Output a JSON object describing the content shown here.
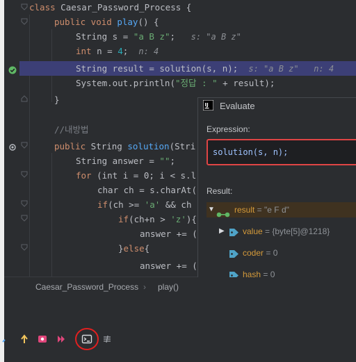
{
  "code_lines": [
    {
      "kw": "class",
      "name": "Caesar_Password_Process",
      "rest": " {"
    },
    {
      "kw": "public void",
      "name": "play",
      "rest": "() {"
    },
    {
      "text": "String s = ",
      "str": "\"a B z\"",
      "rest": ";",
      "hint": "s: \"a B z\""
    },
    {
      "kw": "int",
      "rest": " n = ",
      "num": "4",
      "rest2": ";",
      "hint": "n: 4"
    },
    {
      "text": "String result = solution(s, n);",
      "hint": "s: \"a B z\"   n: 4"
    },
    {
      "text": "System.out.println(",
      "str": "\"정답 : \"",
      "rest": " + result);"
    },
    {
      "text": "}"
    },
    {
      "comment": "//내방법"
    },
    {
      "kw": "public",
      "text": " String ",
      "name": "solution",
      "rest": "(Stri"
    },
    {
      "text": "String answer = ",
      "str": "\"\"",
      "rest": ";"
    },
    {
      "kw": "for",
      "text": " (int i = 0; i < s.l"
    },
    {
      "text": "char ch = s.charAt("
    },
    {
      "kw": "if",
      "text": "(ch >= ",
      "str": "'a'",
      "rest": " && ch"
    },
    {
      "kw": "if",
      "text": "(ch+n > ",
      "str": "'z'",
      "rest": "){"
    },
    {
      "text": "answer += ("
    },
    {
      "text": "}",
      "kw": "else",
      "rest": "{"
    },
    {
      "text": "answer += ("
    }
  ],
  "breadcrumb": {
    "class_name": "Caesar_Password_Process",
    "separator": "›",
    "method": "play()"
  },
  "evaluate": {
    "title": "Evaluate",
    "expression_label": "Expression:",
    "expression": "solution(s, n);",
    "result_label": "Result:",
    "result": {
      "name": "result",
      "value": "\"e F d\""
    },
    "fields": [
      {
        "name": "value",
        "value": "{byte[5]@1218}",
        "expandable": true
      },
      {
        "name": "coder",
        "value": "0",
        "expandable": false
      },
      {
        "name": "hash",
        "value": "0",
        "expandable": false
      }
    ]
  },
  "toolbar_icons": [
    "step-over-icon",
    "step-out-icon",
    "show-frame-icon",
    "resume-icon",
    "evaluate-expression-icon",
    "trace-icon"
  ],
  "colors": {
    "accent": "#56a8f5",
    "highlight": "#3c3f76",
    "annotation": "#e04545"
  }
}
